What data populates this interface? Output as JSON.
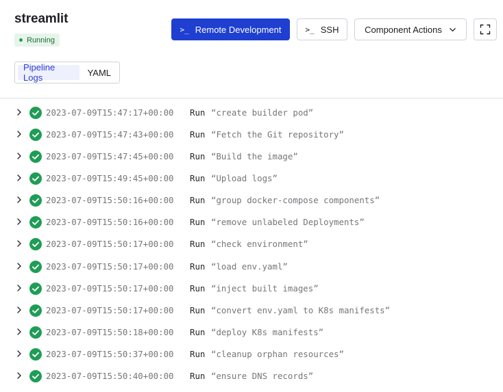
{
  "app": {
    "name": "streamlit",
    "status": "Running"
  },
  "toolbar": {
    "remote_dev_label": "Remote Development",
    "ssh_label": "SSH",
    "component_actions_label": "Component Actions",
    "terminal_glyph": ">_",
    "primary_color": "#1f3fd1"
  },
  "tabs": [
    {
      "label": "Pipeline Logs",
      "active": true
    },
    {
      "label": "YAML",
      "active": false
    }
  ],
  "logs": {
    "run_label": "Run",
    "success_color": "#1f9d55",
    "entries": [
      {
        "timestamp": "2023-07-09T15:47:17+00:00",
        "step": "“create builder pod”"
      },
      {
        "timestamp": "2023-07-09T15:47:43+00:00",
        "step": "“Fetch the Git repository”"
      },
      {
        "timestamp": "2023-07-09T15:47:45+00:00",
        "step": "“Build the image”"
      },
      {
        "timestamp": "2023-07-09T15:49:45+00:00",
        "step": "“Upload logs”"
      },
      {
        "timestamp": "2023-07-09T15:50:16+00:00",
        "step": "“group docker-compose components”"
      },
      {
        "timestamp": "2023-07-09T15:50:16+00:00",
        "step": "“remove unlabeled Deployments”"
      },
      {
        "timestamp": "2023-07-09T15:50:17+00:00",
        "step": "“check environment”"
      },
      {
        "timestamp": "2023-07-09T15:50:17+00:00",
        "step": "“load env.yaml”"
      },
      {
        "timestamp": "2023-07-09T15:50:17+00:00",
        "step": "“inject built images”"
      },
      {
        "timestamp": "2023-07-09T15:50:17+00:00",
        "step": "“convert env.yaml to K8s manifests”"
      },
      {
        "timestamp": "2023-07-09T15:50:18+00:00",
        "step": "“deploy K8s manifests”"
      },
      {
        "timestamp": "2023-07-09T15:50:37+00:00",
        "step": "“cleanup orphan resources”"
      },
      {
        "timestamp": "2023-07-09T15:50:40+00:00",
        "step": "“ensure DNS records”"
      }
    ]
  }
}
